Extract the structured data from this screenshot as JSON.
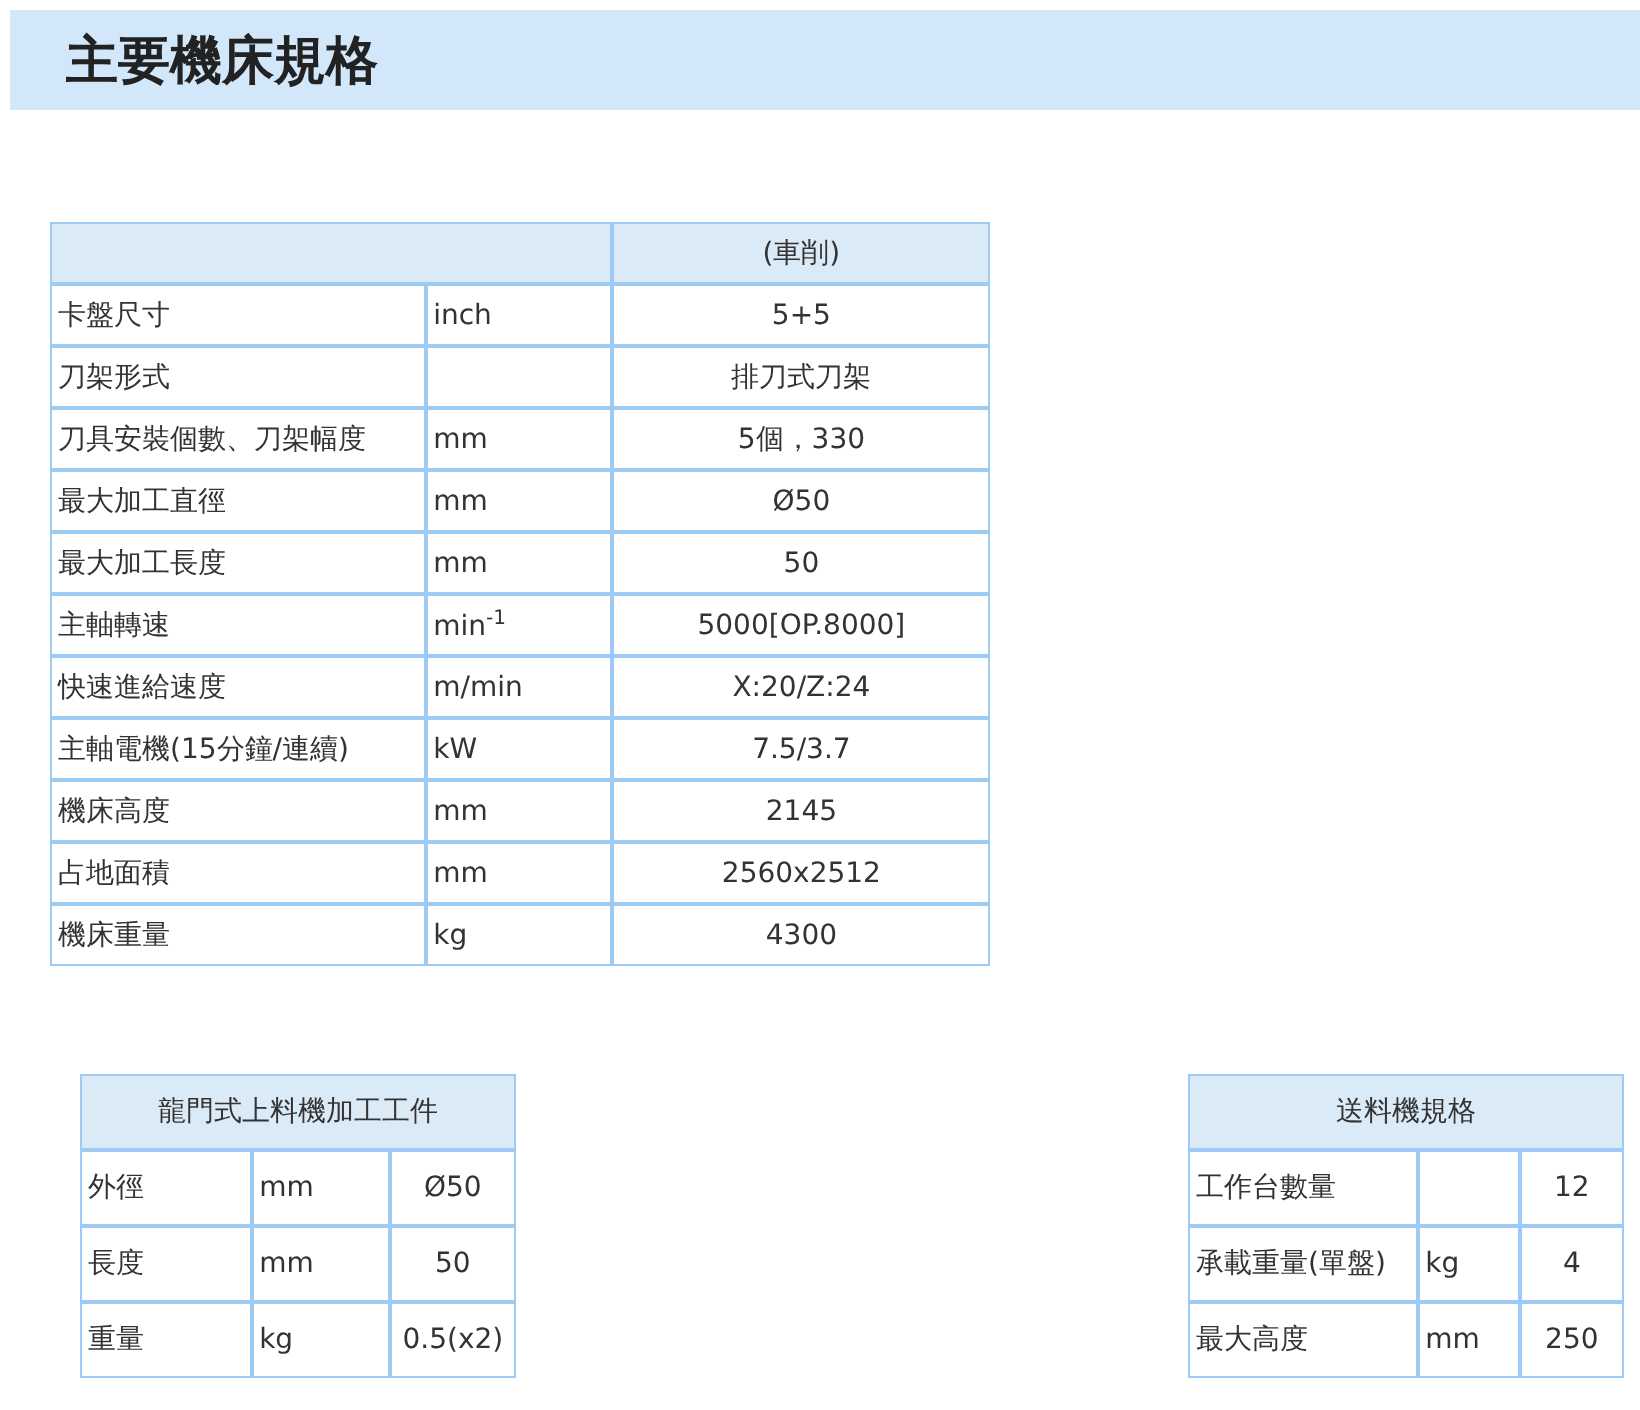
{
  "page_title": "主要機床規格",
  "spec_table": {
    "column_3_header": "(車削)",
    "rows": [
      {
        "item": "卡盤尺寸",
        "unit": "inch",
        "value": "5+5"
      },
      {
        "item": "刀架形式",
        "value": "排刀式刀架"
      },
      {
        "item": "刀具安裝個數、刀架幅度",
        "unit": "mm",
        "value": "5個，330"
      },
      {
        "item": "最大加工直徑",
        "unit": "mm",
        "value": "Ø50"
      },
      {
        "item": "最大加工長度",
        "unit": "mm",
        "value": "50"
      },
      {
        "item": "主軸轉速",
        "unit": "min$^{-1}$",
        "value": "5000[OP.8000]"
      },
      {
        "item": "快速進給速度",
        "unit": "m/min",
        "value": "X:20/Z:24"
      },
      {
        "item": "主軸電機(15分鐘/連續)",
        "unit": "kW",
        "value": "7.5/3.7"
      },
      {
        "item": "機床高度",
        "unit": "mm",
        "value": "2145"
      },
      {
        "item": "占地面積",
        "unit": "mm",
        "value": "2560x2512"
      },
      {
        "item": "機床重量",
        "unit": "kg",
        "value": "4300"
      }
    ]
  },
  "workpiece_table": {
    "title": "龍門式上料機加工工件",
    "rows": [
      {
        "item": "外徑",
        "unit": "mm",
        "value": "Ø50"
      },
      {
        "item": "長度",
        "unit": "mm",
        "value": "50"
      },
      {
        "item": "重量",
        "unit": "kg",
        "value": "0.5(x2)"
      }
    ]
  },
  "feeder_table": {
    "title": "送料機規格",
    "rows": [
      {
        "item": "工作台數量",
        "value": "12"
      },
      {
        "item": "承載重量(單盤)",
        "unit": "kg",
        "value": "4"
      },
      {
        "item": "最大高度",
        "unit": "mm",
        "value": "250"
      }
    ]
  }
}
